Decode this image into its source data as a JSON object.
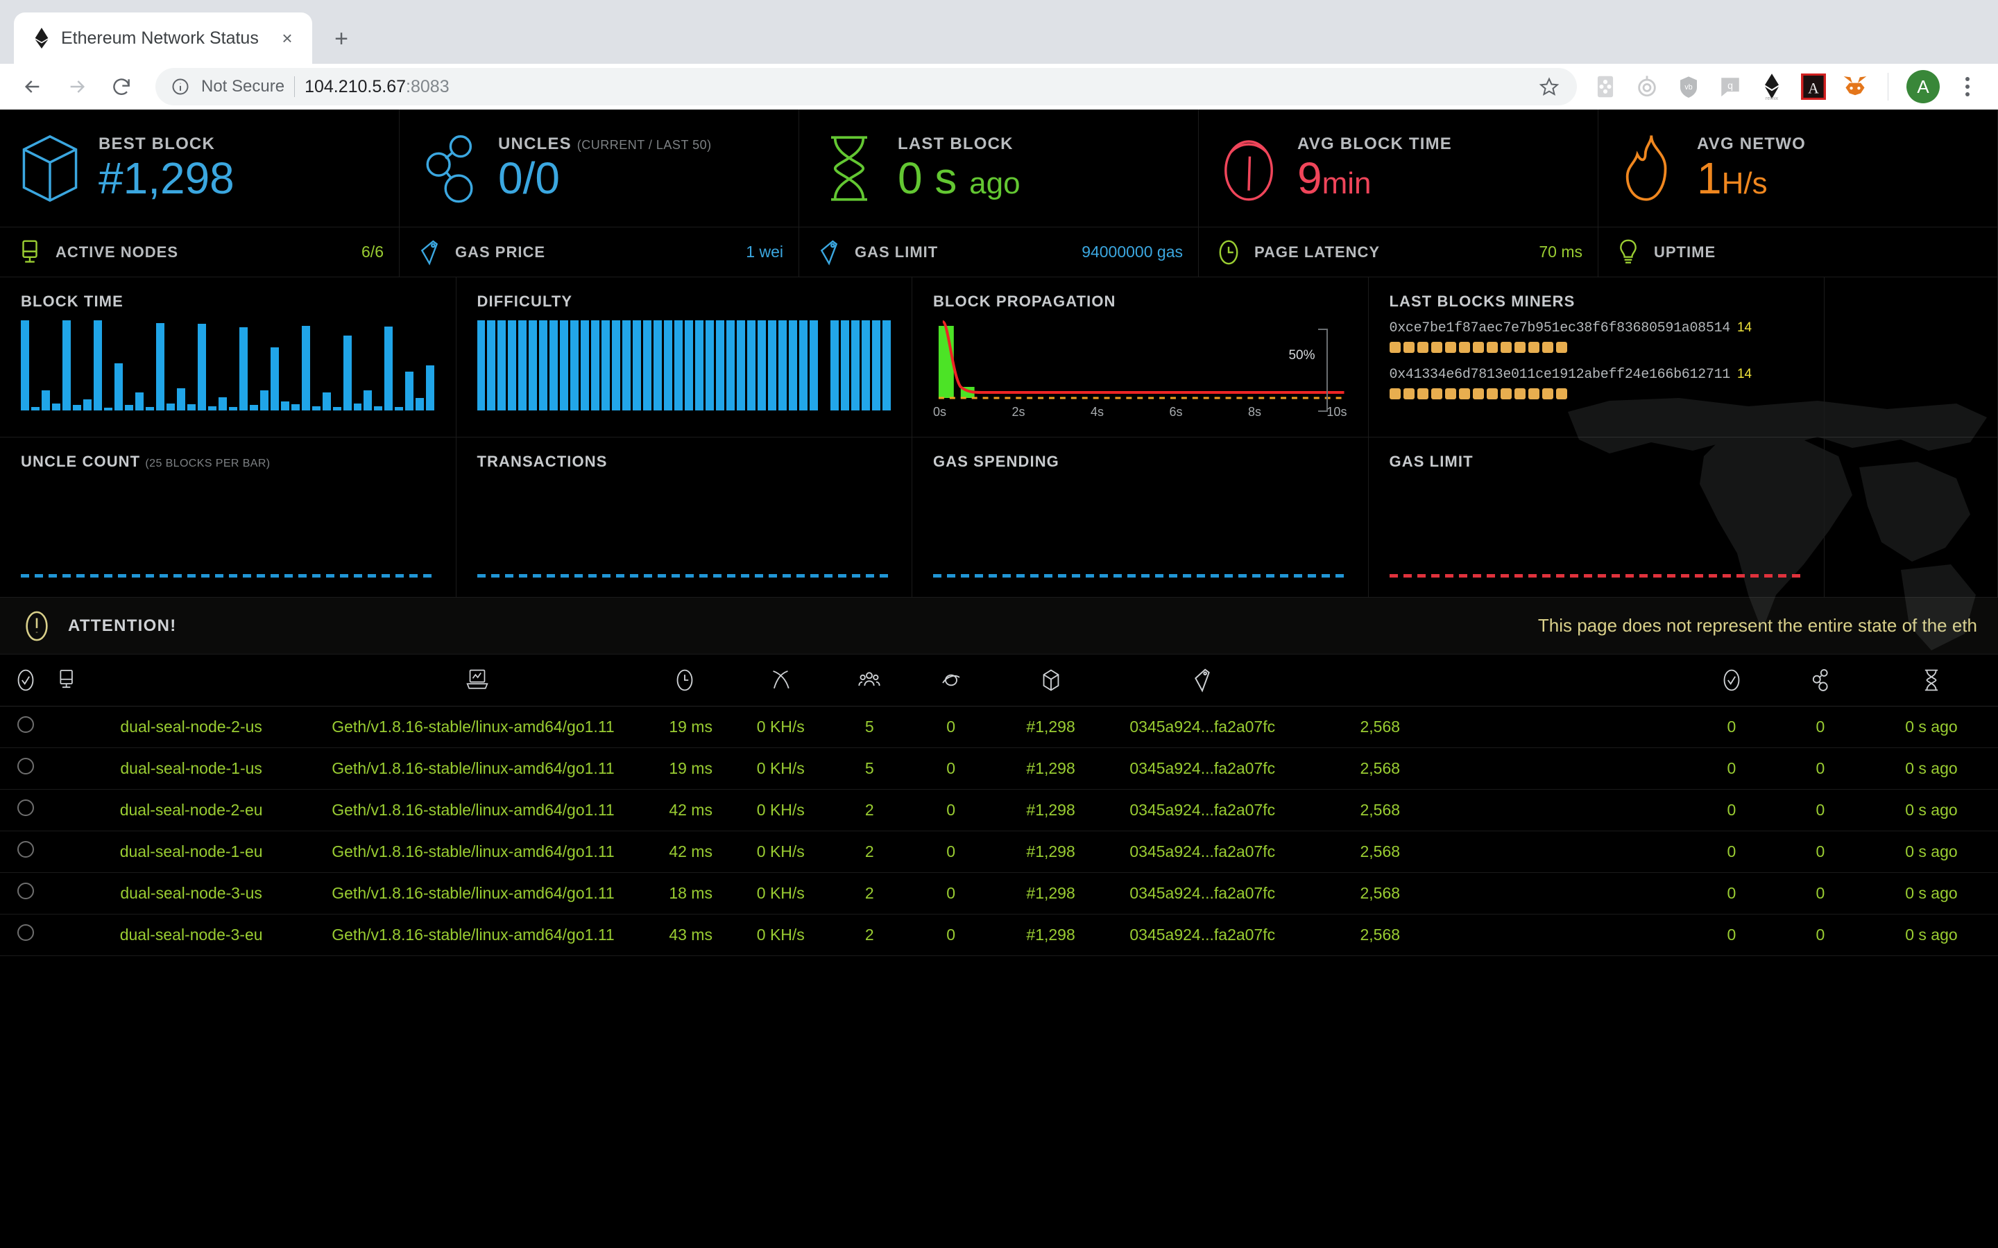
{
  "browser": {
    "tab_title": "Ethereum Network Status",
    "tab_favicon": "ethereum-diamond-icon",
    "close_label": "×",
    "newtab_label": "+",
    "security_label": "Not Secure",
    "url_host": "104.210.5.67",
    "url_port": ":8083",
    "avatar_letter": "A",
    "extensions": [
      {
        "name": "card-extension-icon"
      },
      {
        "name": "target-extension-icon"
      },
      {
        "name": "shield-vb-extension-icon"
      },
      {
        "name": "quote-extension-icon"
      },
      {
        "name": "remix-ethereum-extension-icon",
        "label": "remix"
      },
      {
        "name": "adobe-acrobat-extension-icon"
      },
      {
        "name": "metamask-fox-extension-icon"
      }
    ]
  },
  "dashboard": {
    "big_stats": [
      {
        "icon": "block-cube-icon",
        "label": "BEST BLOCK",
        "sublabel": "",
        "value": "#1,298",
        "unit": "",
        "color": "#3ba7e0"
      },
      {
        "icon": "uncles-nodes-icon",
        "label": "UNCLES",
        "sublabel": "(CURRENT / LAST 50)",
        "value": "0/0",
        "unit": "",
        "color": "#3ba7e0"
      },
      {
        "icon": "hourglass-icon",
        "label": "LAST BLOCK",
        "sublabel": "",
        "value": "0 s",
        "unit": "ago",
        "color": "#63c732"
      },
      {
        "icon": "speedometer-icon",
        "label": "AVG BLOCK TIME",
        "sublabel": "",
        "value": "9",
        "unit": "min",
        "color": "#f0455a"
      },
      {
        "icon": "flame-icon",
        "label": "AVG NETWO",
        "sublabel": "",
        "value": "1",
        "unit": "H/s",
        "color": "#f0871f"
      }
    ],
    "small_stats": [
      {
        "icon": "monitor-icon",
        "label": "ACTIVE NODES",
        "value": "6/6",
        "color": "#9acd32"
      },
      {
        "icon": "gas-tag-icon",
        "label": "GAS PRICE",
        "value": "1 wei",
        "color": "#3ba7e0"
      },
      {
        "icon": "gas-tag-icon",
        "label": "GAS LIMIT",
        "value": "94000000 gas",
        "color": "#3ba7e0"
      },
      {
        "icon": "clock-icon",
        "label": "PAGE LATENCY",
        "value": "70 ms",
        "color": "#9acd32"
      },
      {
        "icon": "lightbulb-icon",
        "label": "UPTIME",
        "value": "",
        "color": "#9acd32"
      }
    ],
    "attention": {
      "icon": "exclamation-circle-icon",
      "label": "ATTENTION!",
      "message": "This page does not represent the entire state of the eth"
    },
    "miners": {
      "title": "LAST BLOCKS MINERS",
      "list": [
        {
          "address": "0xce7be1f87aec7e7b951ec38f6f83680591a08514",
          "count": "14",
          "blocks": 13
        },
        {
          "address": "0x41334e6d7813e011ce1912abeff24e166b612711",
          "count": "14",
          "blocks": 13
        }
      ]
    }
  },
  "chart_data": [
    {
      "type": "bar",
      "title": "BLOCK TIME",
      "subtitle": "",
      "xlabel": "",
      "ylabel": "",
      "categories": [
        "1",
        "2",
        "3",
        "4",
        "5",
        "6",
        "7",
        "8",
        "9",
        "10",
        "11",
        "12",
        "13",
        "14",
        "15",
        "16",
        "17",
        "18",
        "19",
        "20",
        "21",
        "22",
        "23",
        "24",
        "25",
        "26",
        "27",
        "28",
        "29",
        "30",
        "31",
        "32",
        "33",
        "34",
        "35",
        "36",
        "37",
        "38",
        "39",
        "40"
      ],
      "values": [
        100,
        4,
        22,
        8,
        100,
        6,
        12,
        100,
        3,
        52,
        6,
        20,
        4,
        97,
        8,
        25,
        7,
        96,
        5,
        15,
        4,
        92,
        6,
        22,
        70,
        10,
        7,
        94,
        5,
        20,
        4,
        83,
        8,
        22,
        5,
        93,
        4,
        43,
        14,
        50
      ],
      "ylim": [
        0,
        100
      ],
      "grid": false,
      "color": "#20a5e8"
    },
    {
      "type": "bar",
      "title": "DIFFICULTY",
      "subtitle": "",
      "xlabel": "",
      "ylabel": "",
      "categories": [
        "1",
        "2",
        "3",
        "4",
        "5",
        "6",
        "7",
        "8",
        "9",
        "10",
        "11",
        "12",
        "13",
        "14",
        "15",
        "16",
        "17",
        "18",
        "19",
        "20",
        "21",
        "22",
        "23",
        "24",
        "25",
        "26",
        "27",
        "28",
        "29",
        "30",
        "31",
        "32",
        "33",
        "34",
        "35",
        "36",
        "37",
        "38",
        "39",
        "40"
      ],
      "values": [
        100,
        100,
        100,
        100,
        100,
        100,
        100,
        100,
        100,
        100,
        100,
        100,
        100,
        100,
        100,
        100,
        100,
        100,
        100,
        100,
        100,
        100,
        100,
        100,
        100,
        100,
        100,
        100,
        100,
        100,
        100,
        100,
        100,
        0,
        100,
        100,
        100,
        100,
        100,
        100
      ],
      "ylim": [
        0,
        100
      ],
      "grid": false,
      "color": "#22a6e9"
    },
    {
      "type": "area",
      "title": "BLOCK PROPAGATION",
      "subtitle": "",
      "xlabel": "",
      "ylabel": "",
      "x_ticks": [
        "0s",
        "2s",
        "4s",
        "6s",
        "8s",
        "10s"
      ],
      "y_annotation": "50%",
      "series": [
        {
          "name": "histogram",
          "color": "#4ce326",
          "values": [
            92,
            10,
            1,
            0,
            0,
            0,
            0,
            0,
            0,
            0
          ]
        },
        {
          "name": "cumulative",
          "color": "#ee2424",
          "values": [
            100,
            14,
            5,
            4,
            4,
            4,
            4,
            4,
            4,
            4
          ]
        }
      ],
      "ylim": [
        0,
        100
      ],
      "grid": false
    },
    {
      "type": "bar",
      "title": "UNCLE COUNT",
      "subtitle": "(25 BLOCKS PER BAR)",
      "categories": [],
      "values": [],
      "baseline_color": "#2196d6",
      "ylim": [
        0,
        100
      ],
      "grid": false
    },
    {
      "type": "bar",
      "title": "TRANSACTIONS",
      "subtitle": "",
      "categories": [],
      "values": [],
      "baseline_color": "#2196d6",
      "ylim": [
        0,
        100
      ],
      "grid": false
    },
    {
      "type": "bar",
      "title": "GAS SPENDING",
      "subtitle": "",
      "categories": [],
      "values": [],
      "baseline_color": "#2196d6",
      "ylim": [
        0,
        100
      ],
      "grid": false
    },
    {
      "type": "bar",
      "title": "GAS LIMIT",
      "subtitle": "",
      "categories": [],
      "values": [],
      "baseline_color": "#e0323c",
      "ylim": [
        0,
        100
      ],
      "grid": false
    }
  ],
  "node_table": {
    "columns": [
      {
        "icon": "check-shield-icon",
        "name": "status"
      },
      {
        "icon": "monitor-icon",
        "name": "node-name"
      },
      {
        "icon": "laptop-chart-icon",
        "name": "node-info"
      },
      {
        "icon": "clock-icon",
        "name": "latency"
      },
      {
        "icon": "pickaxe-icon",
        "name": "hashrate"
      },
      {
        "icon": "peers-icon",
        "name": "peers"
      },
      {
        "icon": "pending-icon",
        "name": "pending"
      },
      {
        "icon": "block-cube-icon",
        "name": "block"
      },
      {
        "icon": "gas-tag-icon",
        "name": "block-hash"
      },
      {
        "icon": "check-shield-icon",
        "name": "total-difficulty"
      },
      {
        "icon": "uncles-nodes-icon",
        "name": "uncles"
      },
      {
        "icon": "hourglass-icon",
        "name": "last-block"
      }
    ],
    "rows": [
      {
        "status": "",
        "name": "dual-seal-node-2-us",
        "info": "Geth/v1.8.16-stable/linux-amd64/go1.11",
        "latency": "19 ms",
        "hashrate": "0 KH/s",
        "peers": "5",
        "pending": "0",
        "block": "#1,298",
        "hash": "0345a924...fa2a07fc",
        "td": "2,568",
        "spacer": "",
        "uncles": "0",
        "uncles2": "0",
        "lastblock": "0 s ago"
      },
      {
        "status": "",
        "name": "dual-seal-node-1-us",
        "info": "Geth/v1.8.16-stable/linux-amd64/go1.11",
        "latency": "19 ms",
        "hashrate": "0 KH/s",
        "peers": "5",
        "pending": "0",
        "block": "#1,298",
        "hash": "0345a924...fa2a07fc",
        "td": "2,568",
        "spacer": "",
        "uncles": "0",
        "uncles2": "0",
        "lastblock": "0 s ago"
      },
      {
        "status": "",
        "name": "dual-seal-node-2-eu",
        "info": "Geth/v1.8.16-stable/linux-amd64/go1.11",
        "latency": "42 ms",
        "hashrate": "0 KH/s",
        "peers": "2",
        "pending": "0",
        "block": "#1,298",
        "hash": "0345a924...fa2a07fc",
        "td": "2,568",
        "spacer": "",
        "uncles": "0",
        "uncles2": "0",
        "lastblock": "0 s ago"
      },
      {
        "status": "",
        "name": "dual-seal-node-1-eu",
        "info": "Geth/v1.8.16-stable/linux-amd64/go1.11",
        "latency": "42 ms",
        "hashrate": "0 KH/s",
        "peers": "2",
        "pending": "0",
        "block": "#1,298",
        "hash": "0345a924...fa2a07fc",
        "td": "2,568",
        "spacer": "",
        "uncles": "0",
        "uncles2": "0",
        "lastblock": "0 s ago"
      },
      {
        "status": "",
        "name": "dual-seal-node-3-us",
        "info": "Geth/v1.8.16-stable/linux-amd64/go1.11",
        "latency": "18 ms",
        "hashrate": "0 KH/s",
        "peers": "2",
        "pending": "0",
        "block": "#1,298",
        "hash": "0345a924...fa2a07fc",
        "td": "2,568",
        "spacer": "",
        "uncles": "0",
        "uncles2": "0",
        "lastblock": "0 s ago"
      },
      {
        "status": "",
        "name": "dual-seal-node-3-eu",
        "info": "Geth/v1.8.16-stable/linux-amd64/go1.11",
        "latency": "43 ms",
        "hashrate": "0 KH/s",
        "peers": "2",
        "pending": "0",
        "block": "#1,298",
        "hash": "0345a924...fa2a07fc",
        "td": "2,568",
        "spacer": "",
        "uncles": "0",
        "uncles2": "0",
        "lastblock": "0 s ago"
      }
    ]
  }
}
